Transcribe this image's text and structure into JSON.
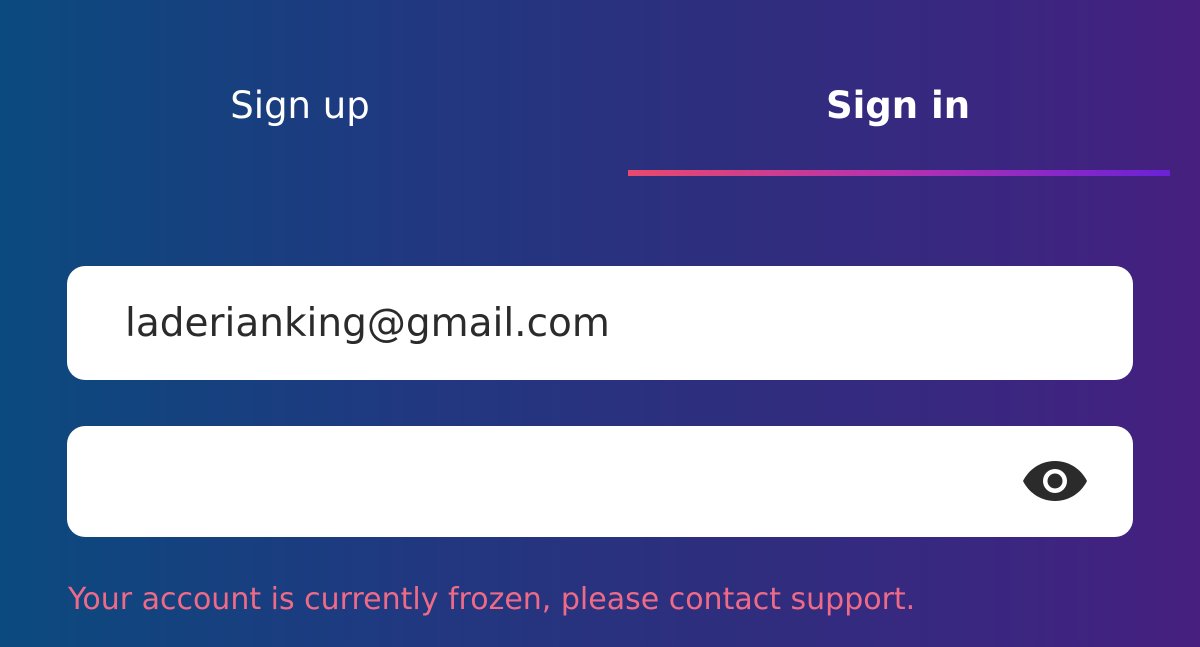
{
  "tabs": {
    "signup_label": "Sign up",
    "signin_label": "Sign in",
    "active": "signin"
  },
  "form": {
    "email_value": "laderianking@gmail.com",
    "password_value": "",
    "password_toggle_icon": "eye-icon"
  },
  "error": {
    "message": "Your account is currently frozen, please contact support."
  },
  "colors": {
    "background_start": "#0b4a7e",
    "background_end": "#461f7f",
    "underline_start": "#e84a6c",
    "underline_end": "#6a22d8",
    "error": "#ee6a87",
    "field_bg": "#ffffff"
  }
}
